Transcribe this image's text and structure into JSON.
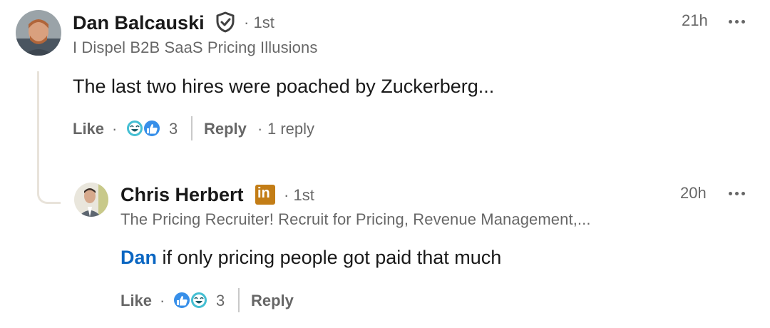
{
  "comments": [
    {
      "author": "Dan Balcauski",
      "verified_icon": "shield-check-icon",
      "degree": "1st",
      "headline": "I Dispel B2B SaaS Pricing Illusions",
      "time": "21h",
      "text": "The last two hires were poached by Zuckerberg...",
      "like_label": "Like",
      "reaction_icons": [
        "funny-reaction-icon",
        "like-reaction-icon"
      ],
      "reaction_count": "3",
      "reply_label": "Reply",
      "replies_text": "1 reply"
    },
    {
      "author": "Chris Herbert",
      "badge_icon": "linkedin-premium-icon",
      "badge_text": "in",
      "degree": "1st",
      "headline": "The Pricing Recruiter! Recruit for Pricing, Revenue Management,...",
      "time": "20h",
      "mention": "Dan",
      "text": "if only pricing people got paid that much",
      "like_label": "Like",
      "reaction_icons": [
        "like-reaction-icon",
        "funny-reaction-icon"
      ],
      "reaction_count": "3",
      "reply_label": "Reply"
    }
  ],
  "colors": {
    "link": "#0a66c2",
    "premium_badge": "#c37d16",
    "like_reaction": "#378fe9",
    "funny_reaction": "#44bfd3"
  }
}
